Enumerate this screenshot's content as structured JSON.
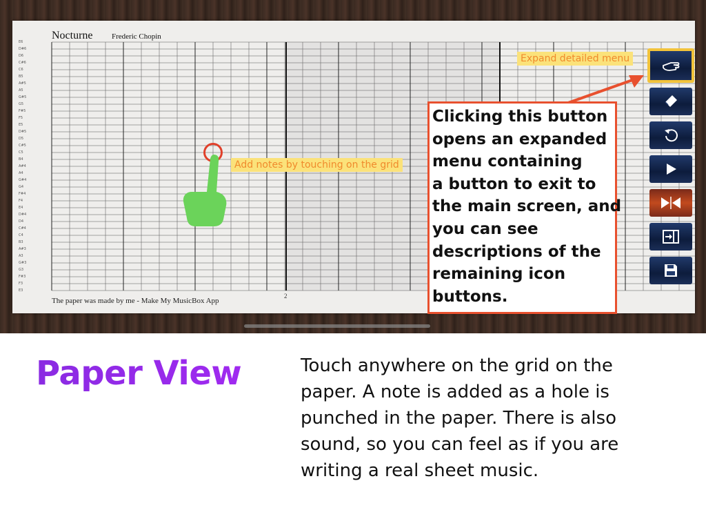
{
  "sheet": {
    "title": "Nocturne",
    "composer": "Frederic Chopin",
    "footer_credit": "The paper was made by me - Make My MusicBox App",
    "page_number": "2",
    "note_labels": [
      "E6",
      "D#6",
      "D6",
      "C#6",
      "C6",
      "B5",
      "A#5",
      "A5",
      "G#5",
      "G5",
      "F#5",
      "F5",
      "E5",
      "D#5",
      "D5",
      "C#5",
      "C5",
      "B4",
      "A#4",
      "A4",
      "G#4",
      "G4",
      "F#4",
      "F4",
      "E4",
      "D#4",
      "D4",
      "C#4",
      "C4",
      "B3",
      "A#3",
      "A3",
      "G#3",
      "G3",
      "F#3",
      "F3",
      "E3"
    ]
  },
  "annotations": {
    "grid_hint": "Add notes by touching on the grid",
    "expand_hint": "Expand detailed menu",
    "info_box_lines": [
      "Clicking this button",
      "opens an expanded",
      "menu containing",
      "a button to exit to",
      "the main screen, and",
      "you can see",
      "descriptions of the",
      "remaining icon",
      "buttons."
    ]
  },
  "toolbar": {
    "buttons": [
      {
        "id": "expand",
        "icon": "hand-point-icon"
      },
      {
        "id": "eraser",
        "icon": "eraser-icon"
      },
      {
        "id": "undo",
        "icon": "undo-icon"
      },
      {
        "id": "play",
        "icon": "play-icon"
      },
      {
        "id": "mirror",
        "icon": "mirror-icon"
      },
      {
        "id": "export",
        "icon": "export-icon"
      },
      {
        "id": "save",
        "icon": "save-icon"
      }
    ],
    "highlight_color": "#f2c33b"
  },
  "caption": {
    "title": "Paper View",
    "title_color": "#8a2be2",
    "text_lines": [
      "Touch anywhere on the grid on the",
      "paper. A note is added as a hole is",
      "punched in the paper. There is also",
      "sound, so you can feel as if you are",
      "writing a real sheet music."
    ]
  },
  "colors": {
    "callout_border": "#e8502e",
    "callout_fill": "#fbe27a",
    "hand": "#6bd35a"
  }
}
